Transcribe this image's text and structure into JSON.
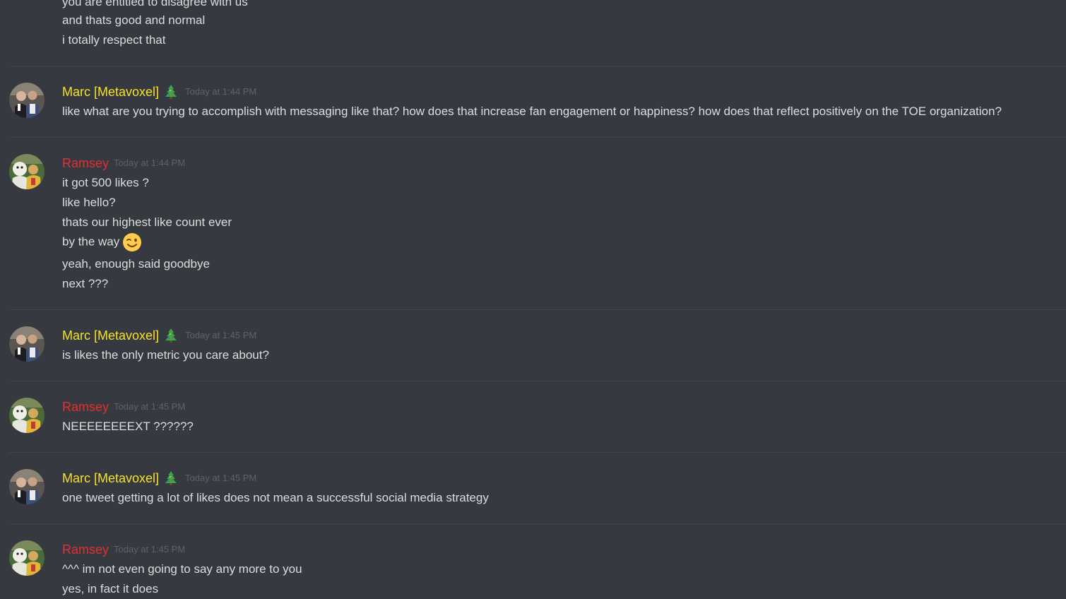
{
  "colors": {
    "background": "#36393f",
    "marc_name": "#f5e22c",
    "ramsey_name": "#e22f2f",
    "message_text": "#dcddde",
    "timestamp": "#5e6269"
  },
  "top_continuation": {
    "lines": [
      "you are entitled to disagree with us",
      "and thats good and normal",
      "i totally respect that"
    ]
  },
  "messages": [
    {
      "author": "Marc [Metavoxel]",
      "badge_icon": "christmas-tree-icon",
      "timestamp": "Today at 1:44 PM",
      "lines": [
        "like what are you trying to accomplish with messaging like that? how does that increase fan engagement or happiness? how does that reflect positively on the TOE organization?"
      ]
    },
    {
      "author": "Ramsey",
      "timestamp": "Today at 1:44 PM",
      "lines": [
        "it got 500 likes ?",
        "like hello?",
        "thats our highest like count ever",
        "by the way",
        "yeah, enough said goodbye",
        "next ???"
      ],
      "inline_emoji": "winking-face-emoji"
    },
    {
      "author": "Marc [Metavoxel]",
      "badge_icon": "christmas-tree-icon",
      "timestamp": "Today at 1:45 PM",
      "lines": [
        "is likes the only metric you care about?"
      ]
    },
    {
      "author": "Ramsey",
      "timestamp": "Today at 1:45 PM",
      "lines": [
        "NEEEEEEEEXT ??????"
      ]
    },
    {
      "author": "Marc [Metavoxel]",
      "badge_icon": "christmas-tree-icon",
      "timestamp": "Today at 1:45 PM",
      "lines": [
        "one tweet getting a lot of likes does not mean a successful social media strategy"
      ]
    },
    {
      "author": "Ramsey",
      "timestamp": "Today at 1:45 PM",
      "lines": [
        "^^^ im not even going to say any more to you",
        "yes, in fact it does"
      ]
    }
  ]
}
